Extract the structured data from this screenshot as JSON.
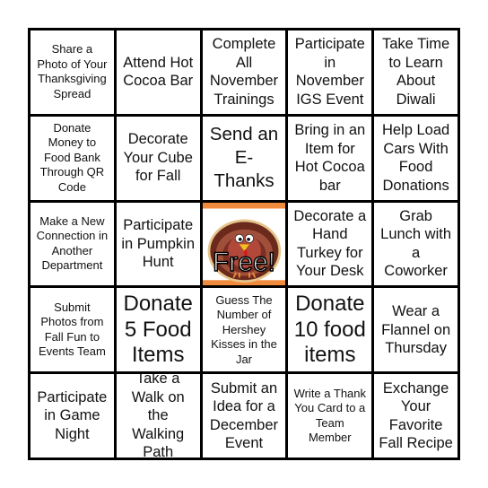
{
  "cells": [
    "Share a Photo of Your Thanksgiving Spread",
    "Attend Hot Cocoa Bar",
    "Complete All November Trainings",
    "Participate in November IGS Event",
    "Take Time to Learn About Diwali",
    "Donate Money to Food Bank Through QR Code",
    "Decorate Your Cube for Fall",
    "Send an E-Thanks",
    "Bring in an Item for Hot Cocoa bar",
    "Help Load Cars With Food Donations",
    "Make a New Connection in Another Department",
    "Participate in Pumpkin Hunt",
    "Free!",
    "Decorate a Hand Turkey for Your Desk",
    "Grab Lunch with a Coworker",
    "Submit Photos from Fall Fun to Events Team",
    "Donate 5 Food Items",
    "Guess The Number of Hershey Kisses in the Jar",
    "Donate 10 food items",
    "Wear a Flannel on Thursday",
    "Participate in Game Night",
    "Take a Walk on the Walking Path",
    "Submit an Idea for a December Event",
    "Write a Thank You Card to a Team Member",
    "Exchange Your Favorite Fall Recipe"
  ],
  "free_space_icon": "turkey-icon",
  "colors": {
    "border": "#000000",
    "free_band": "#f08a3c"
  }
}
